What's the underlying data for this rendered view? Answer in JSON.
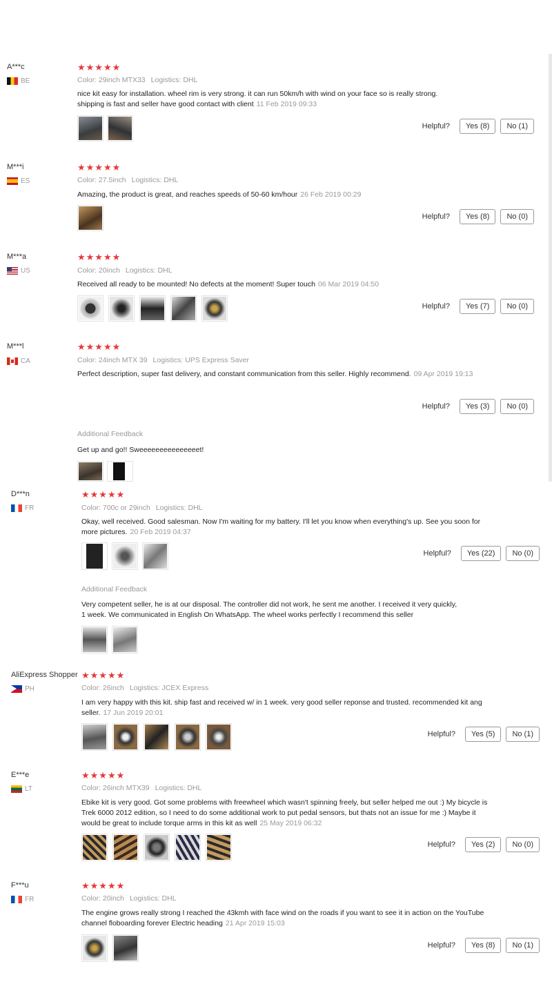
{
  "helpful_label": "Helpful?",
  "additional_label": "Additional Feedback",
  "reviews": [
    {
      "user": "A***c",
      "country": "BE",
      "stars": "★★★★★",
      "color": "Color: 29inch MTX33",
      "logistics": "Logistics: DHL",
      "text": "nice kit easy for installation. wheel rim is very strong. it can run 50km/h with wind on your face so is really strong. shipping is fast and seller have good contact with client",
      "date": "11 Feb 2019 09:33",
      "yes": "Yes (8)",
      "no": "No (1)",
      "photos": 2
    },
    {
      "user": "M***i",
      "country": "ES",
      "stars": "★★★★★",
      "color": "Color: 27.5inch",
      "logistics": "Logistics: DHL",
      "text": "Amazing, the product is great, and reaches speeds of 50-60 km/hour",
      "date": "26 Feb 2019 00:29",
      "yes": "Yes (8)",
      "no": "No (0)",
      "photos": 1
    },
    {
      "user": "M***a",
      "country": "US",
      "stars": "★★★★★",
      "color": "Color: 20inch",
      "logistics": "Logistics: DHL",
      "text": "Received all ready to be mounted! No defects at the moment! Super touch",
      "date": "06 Mar 2019 04:50",
      "yes": "Yes (7)",
      "no": "No (0)",
      "photos": 5
    },
    {
      "user": "M***l",
      "country": "CA",
      "stars": "★★★★★",
      "color": "Color: 24inch MTX 39",
      "logistics": "Logistics: UPS Express Saver",
      "text": "Perfect description, super fast delivery, and constant communication from this seller. Highly recommend.",
      "date": "09 Apr 2019 19:13",
      "yes": "Yes (3)",
      "no": "No (0)",
      "photos": 0,
      "additional": "Get up and go!! Sweeeeeeeeeeeeeeet!"
    },
    {
      "user": "D***n",
      "country": "FR",
      "stars": "★★★★★",
      "color": "Color: 700c or 29inch",
      "logistics": "Logistics: DHL",
      "text": "Okay, well received. Good salesman. Now I'm waiting for my battery. I'll let you know when everything's up. See you soon for more pictures.",
      "date": "20 Feb 2019 04:37",
      "yes": "Yes (22)",
      "no": "No (0)",
      "photos": 3,
      "additional": "Very competent seller, he is at our disposal. The controller did not work, he sent me another. I received it very quickly, 1 week. We communicated in English On WhatsApp. The wheel works perfectly I recommend this seller"
    },
    {
      "user": "AliExpress Shopper",
      "country": "PH",
      "stars": "★★★★★",
      "color": "Color: 26inch",
      "logistics": "Logistics: JCEX Express",
      "text": "I am very happy with this kit. ship fast and received w/ in 1 week. very good seller reponse and trusted. recommended kit ang seller.",
      "date": "17 Jun 2019 20:01",
      "yes": "Yes (5)",
      "no": "No (1)",
      "photos": 5
    },
    {
      "user": "E***e",
      "country": "LT",
      "stars": "★★★★★",
      "color": "Color: 26inch MTX39",
      "logistics": "Logistics: DHL",
      "text": "Ebike kit is very good. Got some problems with freewheel which wasn't spinning freely, but seller helped me out :) My bicycle is Trek 6000 2012 edition, so I need to do some additional work to put pedal sensors, but thats not an issue for me :) Maybe it would be great to include torque arms in this kit as well",
      "date": "25 May 2019 06:32",
      "yes": "Yes (2)",
      "no": "No (0)",
      "photos": 5
    },
    {
      "user": "F***u",
      "country": "FR",
      "stars": "★★★★★",
      "color": "Color: 20inch",
      "logistics": "Logistics: DHL",
      "text": "The engine grows really strong I reached the 43kmh with face wind on the roads if you want to see it in action on the YouTube channel floboarding forever Electric heading",
      "date": "21 Apr 2019 15:03",
      "yes": "Yes (8)",
      "no": "No (1)",
      "photos": 2
    }
  ]
}
